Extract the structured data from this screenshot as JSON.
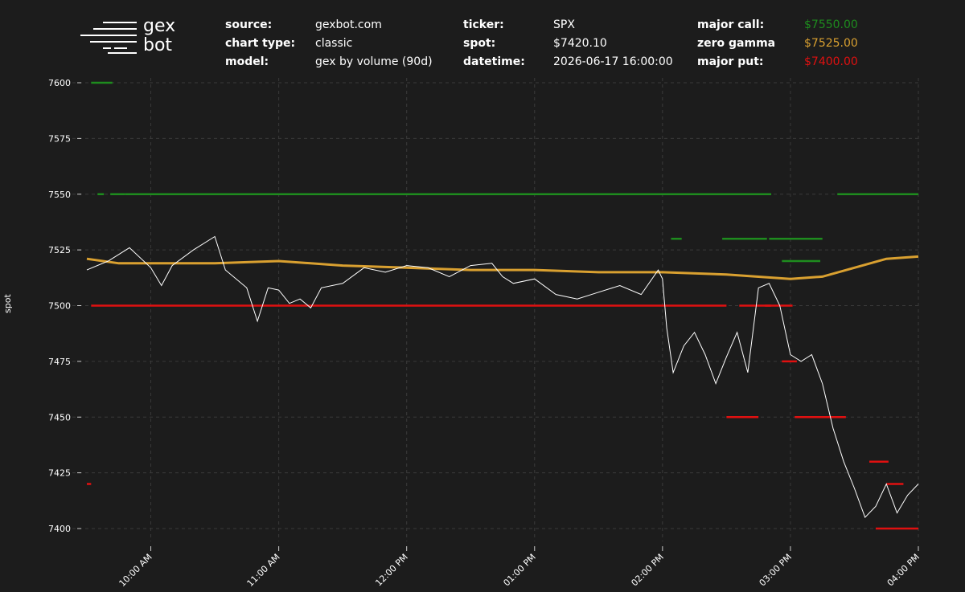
{
  "logo": {
    "line1": "gex",
    "line2": "bot"
  },
  "header": {
    "source_label": "source:",
    "source_value": "gexbot.com",
    "chart_type_label": "chart type:",
    "chart_type_value": "classic",
    "model_label": "model:",
    "model_value": "gex by volume (90d)",
    "ticker_label": "ticker:",
    "ticker_value": "SPX",
    "spot_label": "spot:",
    "spot_value": "$7420.10",
    "datetime_label": "datetime:",
    "datetime_value": "2026-06-17 16:00:00",
    "major_call_label": "major call:",
    "major_call_value": "$7550.00",
    "zero_gamma_label": "zero gamma",
    "zero_gamma_value": "$7525.00",
    "major_put_label": "major put:",
    "major_put_value": "$7400.00"
  },
  "colors": {
    "background": "#1c1c1c",
    "major_call": "#1e8c1e",
    "zero_gamma": "#d9a030",
    "major_put": "#e01010",
    "spot_line": "#ffffff",
    "grid": "#3a3a3a"
  },
  "chart_data": {
    "type": "line",
    "ylabel": "spot",
    "ylim": [
      7400,
      7600
    ],
    "yticks": [
      7400,
      7425,
      7450,
      7475,
      7500,
      7525,
      7550,
      7575,
      7600
    ],
    "xlim": [
      "09:30",
      "16:00"
    ],
    "xticks": [
      "10:00 AM",
      "11:00 AM",
      "12:00 PM",
      "01:00 PM",
      "02:00 PM",
      "03:00 PM",
      "04:00 PM"
    ],
    "grid": true,
    "series": [
      {
        "key": "spot",
        "x": [
          "09:30",
          "09:40",
          "09:50",
          "10:00",
          "10:05",
          "10:10",
          "10:20",
          "10:30",
          "10:35",
          "10:45",
          "10:50",
          "10:55",
          "11:00",
          "11:05",
          "11:10",
          "11:15",
          "11:20",
          "11:30",
          "11:40",
          "11:50",
          "12:00",
          "12:10",
          "12:20",
          "12:30",
          "12:40",
          "12:45",
          "12:50",
          "13:00",
          "13:10",
          "13:20",
          "13:30",
          "13:40",
          "13:50",
          "13:58",
          "14:00",
          "14:02",
          "14:05",
          "14:10",
          "14:15",
          "14:20",
          "14:25",
          "14:30",
          "14:35",
          "14:40",
          "14:45",
          "14:50",
          "14:55",
          "15:00",
          "15:05",
          "15:10",
          "15:15",
          "15:20",
          "15:25",
          "15:30",
          "15:35",
          "15:40",
          "15:45",
          "15:50",
          "15:55",
          "16:00"
        ],
        "values": [
          7516,
          7520,
          7526,
          7517,
          7509,
          7518,
          7525,
          7531,
          7516,
          7508,
          7493,
          7508,
          7507,
          7501,
          7503,
          7499,
          7508,
          7510,
          7517,
          7515,
          7518,
          7517,
          7513,
          7518,
          7519,
          7513,
          7510,
          7512,
          7505,
          7503,
          7506,
          7509,
          7505,
          7516,
          7512,
          7490,
          7470,
          7482,
          7488,
          7478,
          7465,
          7477,
          7488,
          7470,
          7508,
          7510,
          7500,
          7478,
          7475,
          7478,
          7465,
          7445,
          7430,
          7418,
          7405,
          7410,
          7420,
          7407,
          7415,
          7420
        ]
      },
      {
        "key": "zero_gamma",
        "x": [
          "09:30",
          "09:45",
          "10:00",
          "10:30",
          "11:00",
          "11:30",
          "12:00",
          "12:30",
          "13:00",
          "13:30",
          "14:00",
          "14:30",
          "15:00",
          "15:15",
          "15:30",
          "15:45",
          "16:00"
        ],
        "values": [
          7521,
          7519,
          7519,
          7519,
          7520,
          7518,
          7517,
          7516,
          7516,
          7515,
          7515,
          7514,
          7512,
          7513,
          7517,
          7521,
          7522
        ]
      },
      {
        "key": "major_call",
        "segments": [
          {
            "from": "09:32",
            "to": "09:42",
            "value": 7600
          },
          {
            "from": "09:35",
            "to": "09:38",
            "value": 7550
          },
          {
            "from": "09:41",
            "to": "09:48",
            "value": 7550
          },
          {
            "from": "09:48",
            "to": "14:51",
            "value": 7550
          },
          {
            "from": "15:22",
            "to": "16:00",
            "value": 7550
          },
          {
            "from": "14:04",
            "to": "14:09",
            "value": 7530
          },
          {
            "from": "14:28",
            "to": "14:49",
            "value": 7530
          },
          {
            "from": "14:50",
            "to": "15:15",
            "value": 7530
          },
          {
            "from": "14:56",
            "to": "15:14",
            "value": 7520
          }
        ]
      },
      {
        "key": "major_put",
        "segments": [
          {
            "from": "09:32",
            "to": "14:30",
            "value": 7500
          },
          {
            "from": "14:36",
            "to": "14:51",
            "value": 7500
          },
          {
            "from": "14:48",
            "to": "15:01",
            "value": 7500
          },
          {
            "from": "14:30",
            "to": "14:45",
            "value": 7450
          },
          {
            "from": "15:02",
            "to": "15:26",
            "value": 7450
          },
          {
            "from": "14:56",
            "to": "15:03",
            "value": 7475
          },
          {
            "from": "15:37",
            "to": "15:46",
            "value": 7430
          },
          {
            "from": "15:45",
            "to": "15:53",
            "value": 7420
          },
          {
            "from": "15:40",
            "to": "16:00",
            "value": 7400
          },
          {
            "from": "09:30",
            "to": "09:32",
            "value": 7420
          }
        ]
      }
    ]
  }
}
